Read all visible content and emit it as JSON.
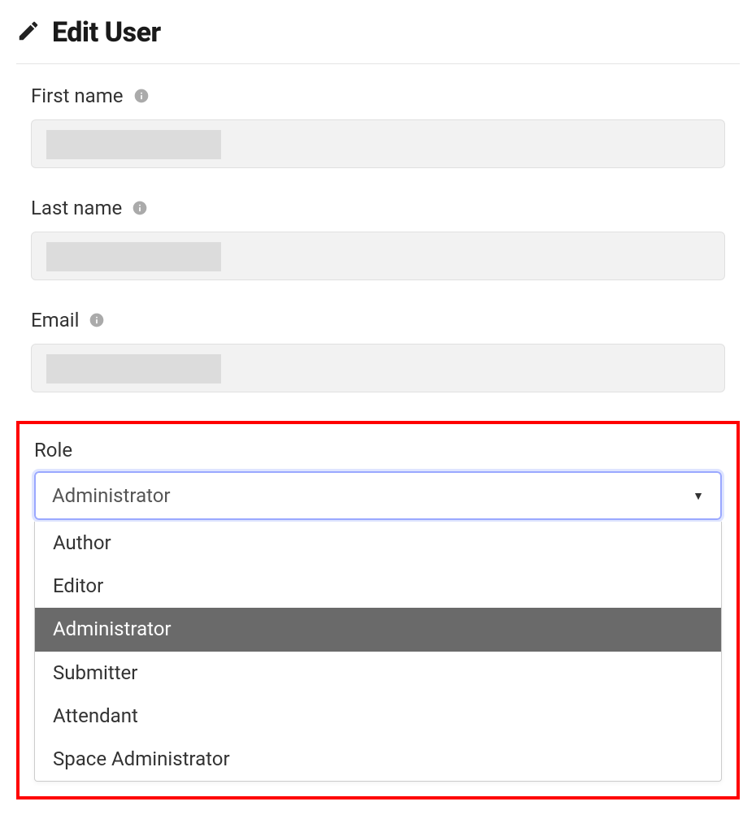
{
  "page": {
    "title": "Edit User"
  },
  "form": {
    "firstName": {
      "label": "First name",
      "value": ""
    },
    "lastName": {
      "label": "Last name",
      "value": ""
    },
    "email": {
      "label": "Email",
      "value": ""
    },
    "role": {
      "label": "Role",
      "selected": "Administrator",
      "options": [
        "Author",
        "Editor",
        "Administrator",
        "Submitter",
        "Attendant",
        "Space Administrator"
      ]
    }
  }
}
